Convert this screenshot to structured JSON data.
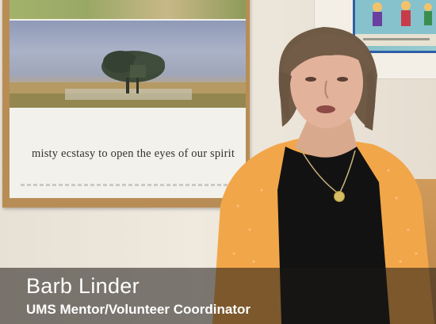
{
  "poster": {
    "caption": "misty ecstasy to open the eyes of our spirit"
  },
  "lower_third": {
    "name": "Barb Linder",
    "title": "UMS Mentor/Volunteer Coordinator"
  },
  "colors": {
    "cardigan": "#f2a64a",
    "shirt": "#111111",
    "frame": "#b88d55",
    "overlay": "#1c1814"
  }
}
